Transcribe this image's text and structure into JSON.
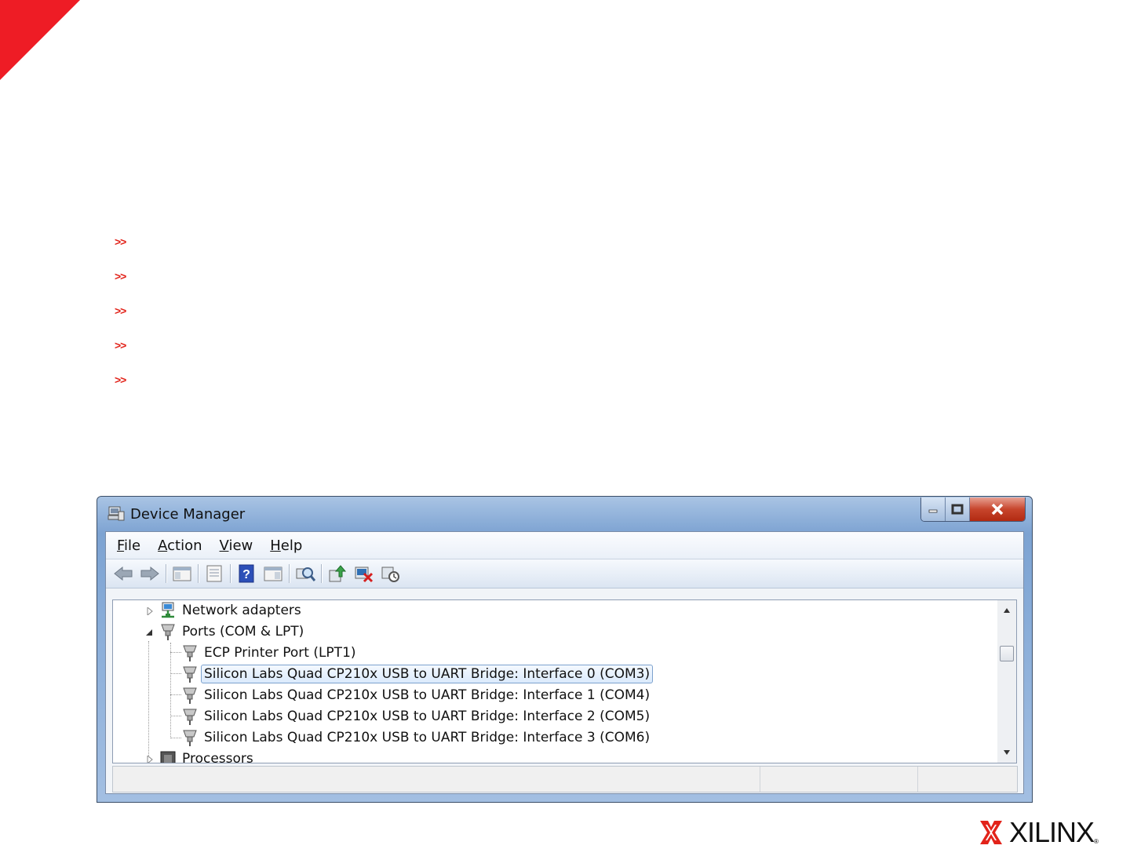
{
  "slide": {
    "bullets": [
      ">>",
      ">>",
      ">>",
      ">>",
      ">>"
    ],
    "accent_color": "#ee1c25"
  },
  "window": {
    "title": "Device Manager",
    "icon": "device-manager-icon",
    "controls": [
      "minimize",
      "maximize",
      "close"
    ],
    "menu": [
      {
        "accel": "F",
        "rest": "ile"
      },
      {
        "accel": "A",
        "rest": "ction"
      },
      {
        "accel": "V",
        "rest": "iew"
      },
      {
        "accel": "H",
        "rest": "elp"
      }
    ],
    "toolbar": [
      "back-icon",
      "forward-icon",
      "show-hide-console-tree-icon",
      "properties-icon",
      "help-icon",
      "action-pane-icon",
      "scan-hardware-icon",
      "update-driver-icon",
      "uninstall-icon",
      "disable-device-icon"
    ]
  },
  "tree": {
    "items": [
      {
        "label": "Network adapters",
        "icon": "network-adapter-icon",
        "expander": "collapsed"
      },
      {
        "label": "Ports (COM & LPT)",
        "icon": "port-icon",
        "expander": "expanded"
      },
      {
        "label": "ECP Printer Port (LPT1)",
        "icon": "port-icon"
      },
      {
        "label": "Silicon Labs Quad CP210x USB to UART Bridge: Interface 0 (COM3)",
        "icon": "port-icon",
        "selected": true
      },
      {
        "label": "Silicon Labs Quad CP210x USB to UART Bridge: Interface 1 (COM4)",
        "icon": "port-icon"
      },
      {
        "label": "Silicon Labs Quad CP210x USB to UART Bridge: Interface 2 (COM5)",
        "icon": "port-icon"
      },
      {
        "label": "Silicon Labs Quad CP210x USB to UART Bridge: Interface 3 (COM6)",
        "icon": "port-icon"
      },
      {
        "label": "Processors",
        "icon": "processor-icon",
        "expander": "collapsed"
      }
    ]
  },
  "logo": {
    "text": "XILINX",
    "mark": "®"
  }
}
